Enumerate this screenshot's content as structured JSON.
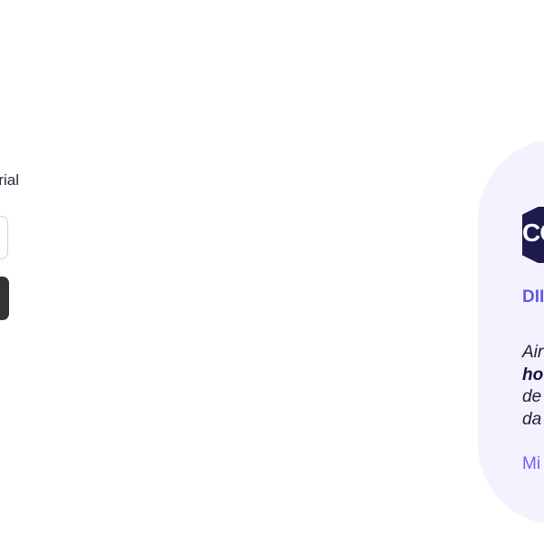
{
  "signup": {
    "trial_text": "ee trial",
    "email_value": "",
    "submit_label": ""
  },
  "testimonial": {
    "logo_text": "CO",
    "label": "DII",
    "quote_lines": [
      "Air",
      "ho",
      "de",
      "da"
    ],
    "link_text": "Mi"
  },
  "colors": {
    "accent": "#6159e8",
    "card_background": "#f3f2fe",
    "logo_background": "#1d1b4b",
    "button_background": "#333333"
  }
}
